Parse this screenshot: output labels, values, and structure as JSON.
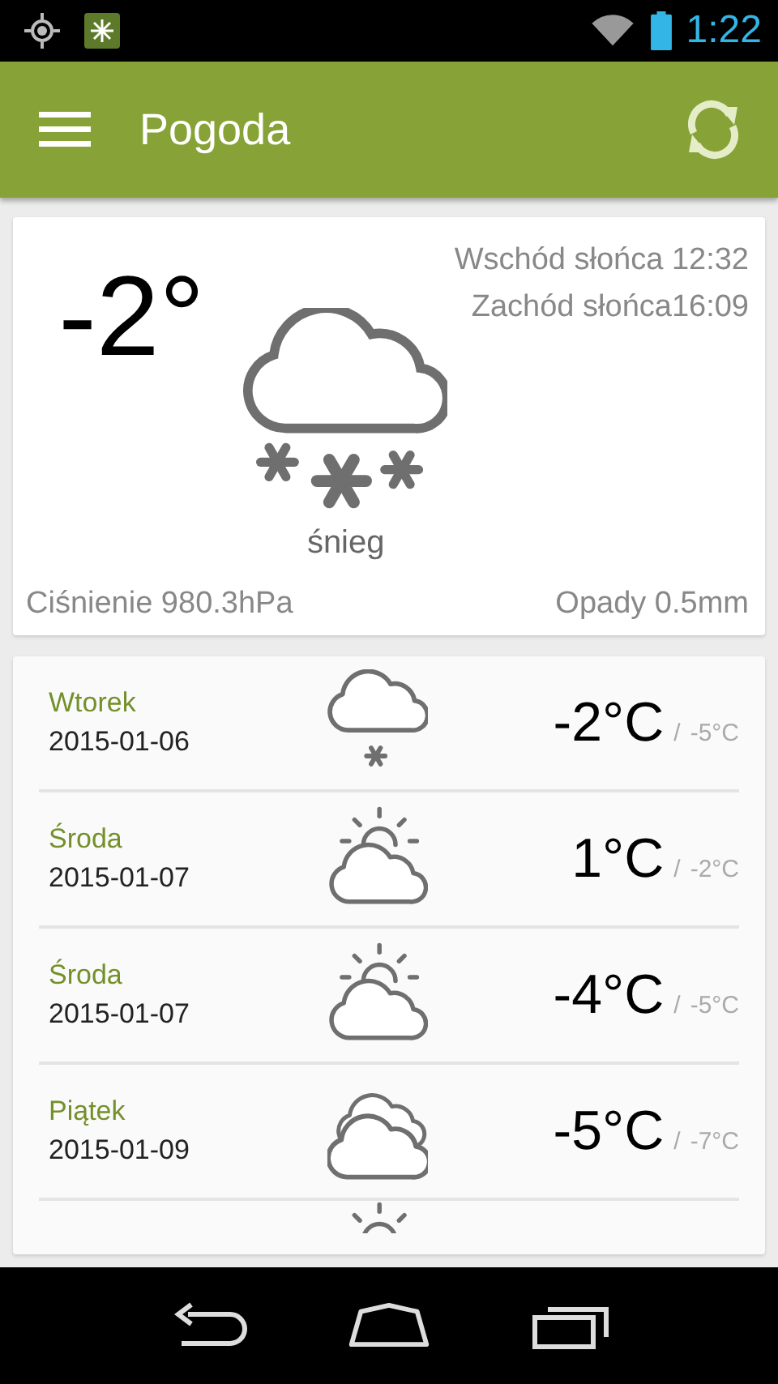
{
  "status_bar": {
    "time": "1:22"
  },
  "app_bar": {
    "title": "Pogoda"
  },
  "current": {
    "temperature": "-2°",
    "sunrise": "Wschód słońca 12:32",
    "sunset": "Zachód słońca16:09",
    "kind": "snow",
    "condition": "śnieg",
    "pressure": "Ciśnienie 980.3hPa",
    "precipitation": "Opady 0.5mm"
  },
  "forecast": [
    {
      "day": "Wtorek",
      "date": "2015-01-06",
      "kind": "snow",
      "high": "-2°C",
      "separator": "/",
      "low": "-5°C"
    },
    {
      "day": "Środa",
      "date": "2015-01-07",
      "kind": "partly_cloudy",
      "high": "1°C",
      "separator": "/",
      "low": "-2°C"
    },
    {
      "day": "Środa",
      "date": "2015-01-07",
      "kind": "partly_cloudy",
      "high": "-4°C",
      "separator": "/",
      "low": "-5°C"
    },
    {
      "day": "Piątek",
      "date": "2015-01-09",
      "kind": "cloudy",
      "high": "-5°C",
      "separator": "/",
      "low": "-7°C"
    }
  ],
  "forecast_partial": {
    "kind": "partly_cloudy"
  }
}
